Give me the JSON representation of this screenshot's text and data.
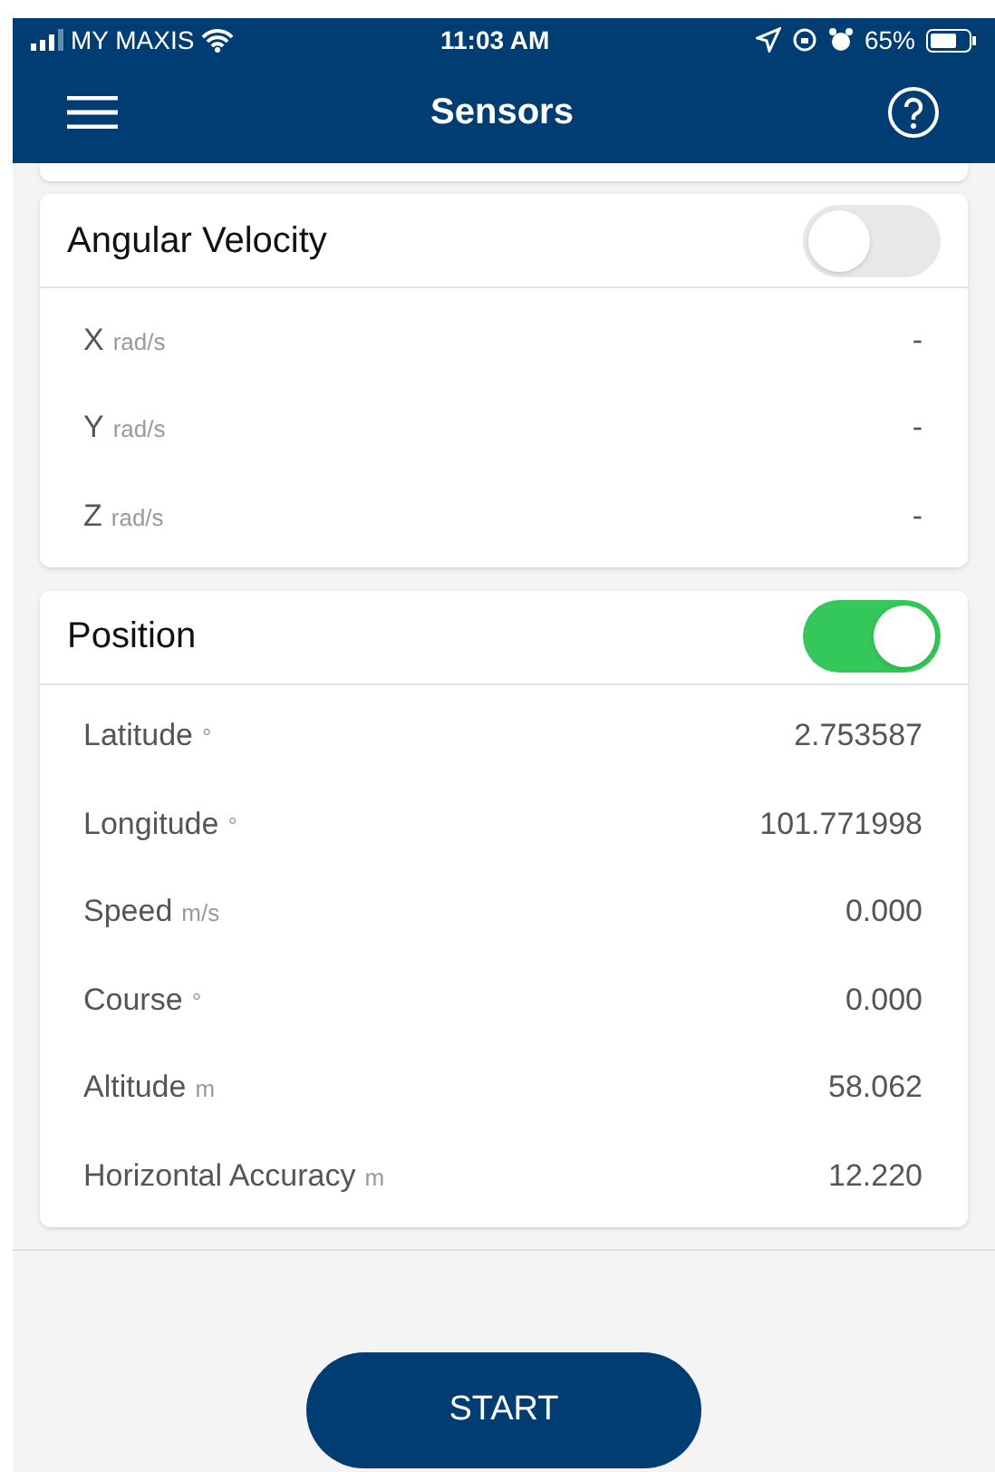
{
  "status_bar": {
    "carrier": "MY MAXIS",
    "time": "11:03 AM",
    "battery": "65%"
  },
  "header": {
    "title": "Sensors"
  },
  "sections": [
    {
      "title": "Angular Velocity",
      "on": false,
      "rows": [
        {
          "label": "X",
          "unit": "rad/s",
          "value": "-"
        },
        {
          "label": "Y",
          "unit": "rad/s",
          "value": "-"
        },
        {
          "label": "Z",
          "unit": "rad/s",
          "value": "-"
        }
      ]
    },
    {
      "title": "Position",
      "on": true,
      "rows": [
        {
          "label": "Latitude",
          "unit": "°",
          "value": "2.753587"
        },
        {
          "label": "Longitude",
          "unit": "°",
          "value": "101.771998"
        },
        {
          "label": "Speed",
          "unit": "m/s",
          "value": "0.000"
        },
        {
          "label": "Course",
          "unit": "°",
          "value": "0.000"
        },
        {
          "label": "Altitude",
          "unit": "m",
          "value": "58.062"
        },
        {
          "label": "Horizontal Accuracy",
          "unit": "m",
          "value": "12.220"
        }
      ]
    }
  ],
  "start_button": "START"
}
